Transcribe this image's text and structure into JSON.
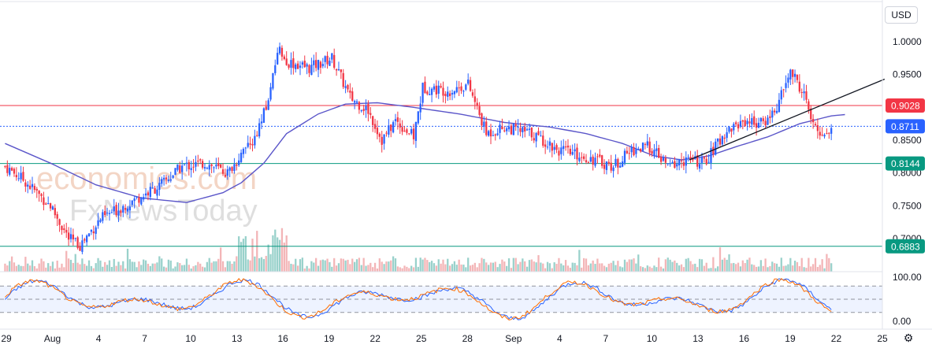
{
  "currency_button": "USD",
  "watermark": {
    "line1": "economies.com",
    "line2": "FxNewsToday"
  },
  "settings_icon": "gear-icon",
  "chart_data": {
    "type": "candlestick",
    "y_axis": {
      "min": 0.66,
      "max": 1.03,
      "ticks": [
        "1.0000",
        "0.9500",
        "0.9000",
        "0.8500",
        "0.8000",
        "0.7500",
        "0.7000"
      ]
    },
    "x_axis_ticks": [
      "29",
      "Aug",
      "4",
      "7",
      "10",
      "13",
      "16",
      "19",
      "22",
      "25",
      "28",
      "Sep",
      "4",
      "7",
      "10",
      "13",
      "16",
      "19",
      "22",
      "25"
    ],
    "price_levels": [
      {
        "label": "0.9028",
        "value": 0.9028,
        "color": "#f23645",
        "style": "solid"
      },
      {
        "label": "0.8711",
        "value": 0.8711,
        "color": "#2962ff",
        "style": "dotted"
      },
      {
        "label": "0.8144",
        "value": 0.8144,
        "color": "#089981",
        "style": "solid"
      },
      {
        "label": "0.6883",
        "value": 0.6883,
        "color": "#089981",
        "style": "solid"
      }
    ],
    "key_path": [
      [
        0,
        0.81
      ],
      [
        8,
        0.79
      ],
      [
        20,
        0.75
      ],
      [
        28,
        0.7
      ],
      [
        33,
        0.69
      ],
      [
        42,
        0.73
      ],
      [
        55,
        0.755
      ],
      [
        68,
        0.78
      ],
      [
        78,
        0.81
      ],
      [
        88,
        0.815
      ],
      [
        98,
        0.8
      ],
      [
        110,
        0.85
      ],
      [
        116,
        0.91
      ],
      [
        120,
        0.99
      ],
      [
        124,
        0.97
      ],
      [
        134,
        0.96
      ],
      [
        144,
        0.975
      ],
      [
        152,
        0.915
      ],
      [
        160,
        0.895
      ],
      [
        166,
        0.85
      ],
      [
        172,
        0.88
      ],
      [
        180,
        0.855
      ],
      [
        184,
        0.93
      ],
      [
        196,
        0.925
      ],
      [
        204,
        0.935
      ],
      [
        212,
        0.86
      ],
      [
        220,
        0.87
      ],
      [
        232,
        0.86
      ],
      [
        244,
        0.835
      ],
      [
        260,
        0.82
      ],
      [
        268,
        0.81
      ],
      [
        276,
        0.835
      ],
      [
        284,
        0.84
      ],
      [
        292,
        0.81
      ],
      [
        300,
        0.82
      ],
      [
        308,
        0.815
      ],
      [
        318,
        0.865
      ],
      [
        326,
        0.88
      ],
      [
        334,
        0.875
      ],
      [
        340,
        0.9
      ],
      [
        346,
        0.955
      ],
      [
        352,
        0.92
      ],
      [
        356,
        0.87
      ],
      [
        360,
        0.86
      ],
      [
        364,
        0.865
      ]
    ],
    "ma_path": [
      [
        0,
        0.845
      ],
      [
        20,
        0.815
      ],
      [
        40,
        0.782
      ],
      [
        60,
        0.762
      ],
      [
        80,
        0.755
      ],
      [
        96,
        0.77
      ],
      [
        104,
        0.785
      ],
      [
        114,
        0.815
      ],
      [
        124,
        0.86
      ],
      [
        138,
        0.89
      ],
      [
        150,
        0.905
      ],
      [
        164,
        0.907
      ],
      [
        180,
        0.9
      ],
      [
        200,
        0.89
      ],
      [
        220,
        0.877
      ],
      [
        240,
        0.87
      ],
      [
        256,
        0.86
      ],
      [
        272,
        0.845
      ],
      [
        286,
        0.826
      ],
      [
        298,
        0.82
      ],
      [
        310,
        0.826
      ],
      [
        322,
        0.84
      ],
      [
        336,
        0.855
      ],
      [
        350,
        0.875
      ],
      [
        364,
        0.887
      ],
      [
        370,
        0.889
      ]
    ],
    "trendline": {
      "from": [
        302,
        0.82
      ],
      "to": [
        388,
        0.943
      ]
    },
    "n_bars": 365,
    "oscillator": {
      "type": "stochastic",
      "ticks": [
        "100.00",
        "0.00"
      ],
      "band": [
        20,
        80
      ],
      "mid": 50,
      "series": [
        {
          "color": "#2962ff"
        },
        {
          "color": "#ff6d00"
        }
      ]
    }
  }
}
